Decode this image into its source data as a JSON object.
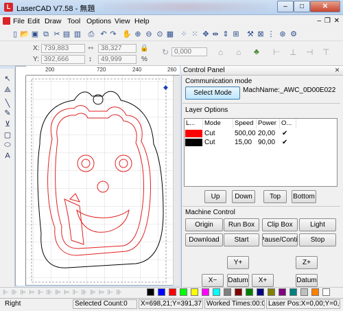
{
  "window": {
    "title": "LaserCAD V7.58 - 無題",
    "app_icon": "lasercad-logo-icon",
    "controls": [
      "minimize",
      "maximize",
      "close"
    ]
  },
  "menu": {
    "items": [
      "File",
      "Edit",
      "Draw",
      "Tool",
      "Options",
      "View",
      "Help"
    ]
  },
  "toolbar": {
    "icons": [
      "new-file-icon",
      "open-file-icon",
      "save-icon",
      "copy-icon",
      "cut-icon",
      "paste-icon",
      "undo-icon",
      "redo-icon",
      "zoom-in-icon",
      "zoom-out-icon",
      "pan-icon",
      "zoom-select-icon",
      "zoom-page-icon",
      "zoom-fit-icon",
      "group-icon",
      "ungroup-icon",
      "node-edit-icon",
      "mirror-h-icon",
      "mirror-v-icon",
      "align-icon",
      "settings-icon"
    ]
  },
  "coordinates": {
    "x_label": "X:",
    "x_value": "739,883",
    "y_label": "Y:",
    "y_value": "392,666",
    "width_value": "38,327",
    "height_value": "49,999",
    "percent_label": "%",
    "rotate_value": "0,000"
  },
  "rulers": {
    "top": [
      "200",
      "720",
      "240",
      "260"
    ],
    "left": [
      "80",
      "20",
      "40",
      "60",
      "80",
      "100"
    ]
  },
  "left_tools": [
    "select-tool-icon",
    "node-tool-icon",
    "line-tool-icon",
    "pen-tool-icon",
    "polyline-tool-icon",
    "rectangle-tool-icon",
    "ellipse-tool-icon",
    "text-tool-icon"
  ],
  "panel": {
    "title": "Control Panel",
    "communication_mode": "Communication mode",
    "select_mode": "Select Mode",
    "machine_name": "MachName:_AWC_0D00E022",
    "layer_options": "Layer Options",
    "table_headers": [
      "L...",
      "Mode",
      "Speed",
      "Power",
      "O..."
    ],
    "layers": [
      {
        "color": "#ff0000",
        "mode": "Cut",
        "speed": "500,00",
        "power": "20,00",
        "output": "✔"
      },
      {
        "color": "#000000",
        "mode": "Cut",
        "speed": "15,00",
        "power": "90,00",
        "output": "✔"
      }
    ],
    "layer_buttons": [
      "Up",
      "Down",
      "Top",
      "Bottom"
    ],
    "machine_control": "Machine Control",
    "control_buttons_row1": [
      "Origin",
      "Run Box",
      "Clip Box",
      "Light"
    ],
    "control_buttons_row2": [
      "Download",
      "Start",
      "Pause/Continue",
      "Stop"
    ],
    "y_plus": "Y+",
    "z_plus": "Z+",
    "x_minus": "X−",
    "datum": "Datum",
    "x_plus": "X+",
    "z_datum": "Datum"
  },
  "palette": [
    "#000000",
    "#0000ff",
    "#ff0000",
    "#00ff00",
    "#ffff00",
    "#ff00ff",
    "#00ffff",
    "#808080",
    "#800000",
    "#008000",
    "#000080",
    "#808000",
    "#800080",
    "#008080",
    "#c0c0c0",
    "#ff8000",
    "#ffffff"
  ],
  "status": {
    "state": "Right",
    "selected": "Selected Count:0",
    "position": "X=698,21;Y=391,37",
    "worked": "Worked Times:00:00",
    "laser_pos": "Laser Pos:X=0,00;Y=0,00"
  }
}
